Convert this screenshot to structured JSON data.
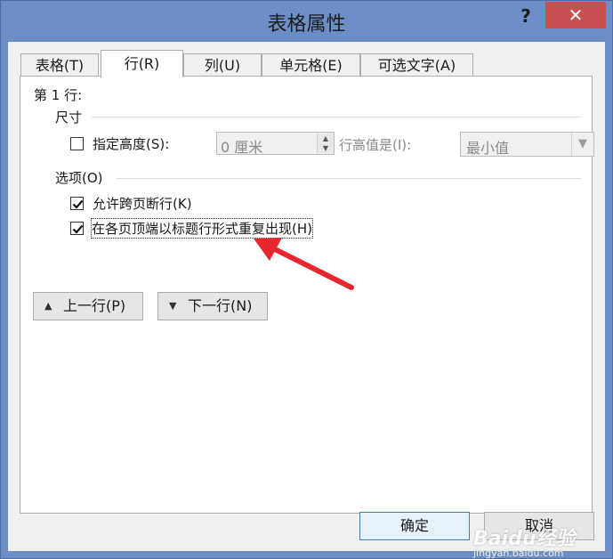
{
  "window": {
    "title": "表格属性",
    "help_label": "?",
    "close_label": "✕"
  },
  "tabs": [
    {
      "label": "表格(T)",
      "active": false
    },
    {
      "label": "行(R)",
      "active": true
    },
    {
      "label": "列(U)",
      "active": false
    },
    {
      "label": "单元格(E)",
      "active": false
    },
    {
      "label": "可选文字(A)",
      "active": false
    }
  ],
  "row_tab": {
    "row_heading": "第 1 行:",
    "size_group": "尺寸",
    "specify_height": {
      "label": "指定高度(S):",
      "checked": false
    },
    "height_value": "0 厘米",
    "row_height_is_label": "行高值是(I):",
    "row_height_mode": "最小值",
    "options_group": "选项(O)",
    "allow_break": {
      "label": "允许跨页断行(K)",
      "checked": true
    },
    "repeat_header": {
      "label": "在各页顶端以标题行形式重复出现(H)",
      "checked": true
    },
    "prev_row": "上一行(P)",
    "next_row": "下一行(N)"
  },
  "footer": {
    "ok": "确定",
    "cancel": "取消"
  },
  "watermark": {
    "text": "Baidu经验",
    "sub": "jingyan.baidu.com"
  },
  "colors": {
    "titlebar": "#6b8ec6",
    "close_button": "#c75050",
    "arrow": "#e8262f"
  }
}
